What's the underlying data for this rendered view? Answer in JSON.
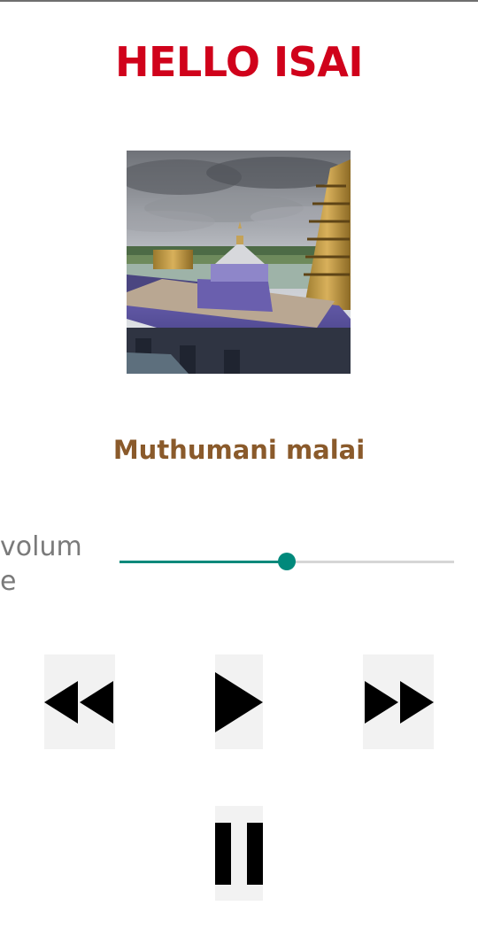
{
  "app": {
    "title": "HELLO ISAI"
  },
  "album_art": {
    "description_icon": "album-art-image"
  },
  "track": {
    "title": "Muthumani malai"
  },
  "volume": {
    "label": "volume",
    "level": 0.5
  },
  "controls": {
    "rewind_icon": "rewind-icon",
    "play_icon": "play-icon",
    "forward_icon": "fast-forward-icon",
    "pause_icon": "pause-icon"
  },
  "colors": {
    "title": "#d0021b",
    "song_title": "#8a5a2b",
    "volume_label": "#7a7a7a",
    "accent": "#00897b",
    "icon": "#000000",
    "button_bg": "#f2f2f2"
  }
}
